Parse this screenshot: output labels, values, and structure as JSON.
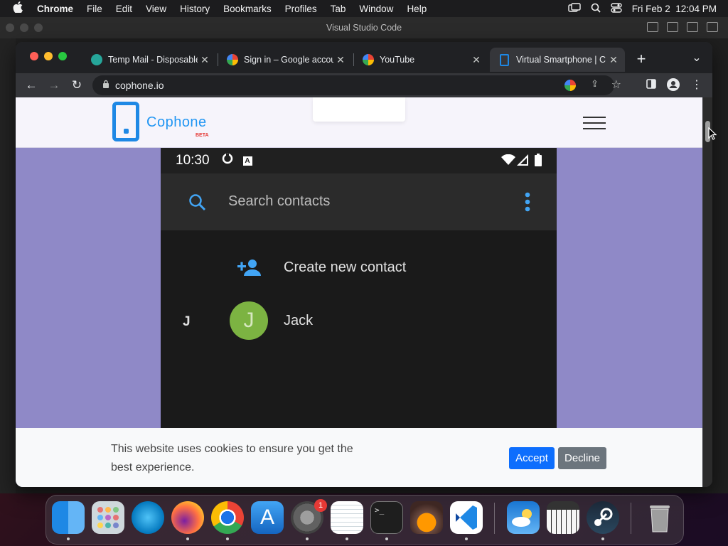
{
  "menubar": {
    "app": "Chrome",
    "items": [
      "File",
      "Edit",
      "View",
      "History",
      "Bookmarks",
      "Profiles",
      "Tab",
      "Window",
      "Help"
    ],
    "datetime": "Fri Feb 2  12:04 PM"
  },
  "vscode": {
    "title": "Visual Studio Code"
  },
  "browser": {
    "tabs": [
      {
        "title": "Temp Mail - Disposable"
      },
      {
        "title": "Sign in – Google account"
      },
      {
        "title": "YouTube"
      },
      {
        "title": "Virtual Smartphone | C"
      }
    ],
    "new_tab": "+",
    "tab_menu": "⌄",
    "url": "cophone.io"
  },
  "site": {
    "brand": "Cophone",
    "beta": "BETA"
  },
  "phone": {
    "time": "10:30",
    "search_placeholder": "Search contacts",
    "create_contact": "Create new contact",
    "section_letter": "J",
    "contact_initial": "J",
    "contact_name": "Jack"
  },
  "cookie": {
    "message": "This website uses cookies to ensure you get the best experience.",
    "accept": "Accept",
    "decline": "Decline"
  },
  "dock": {
    "badge_count": "1"
  },
  "colors": {
    "brand_blue": "#1e88e5",
    "page_bg": "#8f89c7",
    "accept": "#0d6efd",
    "decline": "#6c757d",
    "avatar": "#7cb342"
  }
}
